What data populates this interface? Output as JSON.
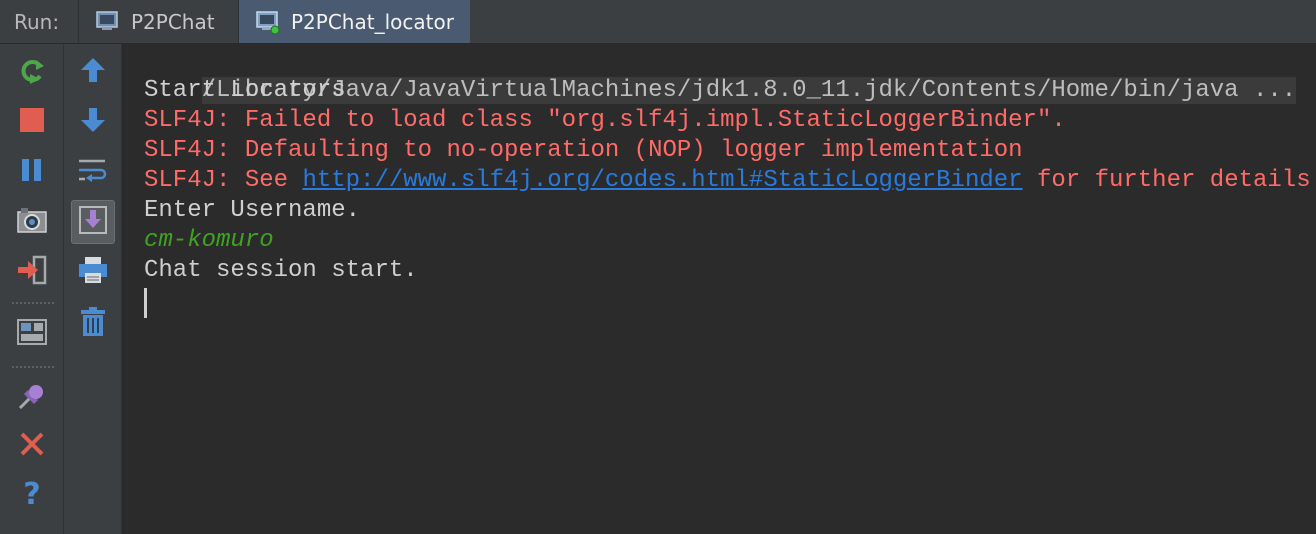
{
  "run_label": "Run:",
  "tabs": [
    {
      "label": "P2PChat",
      "active": false
    },
    {
      "label": "P2PChat_locator",
      "active": true
    }
  ],
  "left_toolbar": [
    {
      "icon": "rerun-icon"
    },
    {
      "icon": "stop-icon"
    },
    {
      "icon": "pause-icon"
    },
    {
      "icon": "camera-icon"
    },
    {
      "icon": "exit-icon"
    },
    {
      "icon": "layout-icon"
    },
    {
      "icon": "pin-icon"
    },
    {
      "icon": "close-icon"
    },
    {
      "icon": "help-icon"
    }
  ],
  "right_toolbar": [
    {
      "icon": "arrow-up-icon"
    },
    {
      "icon": "arrow-down-icon"
    },
    {
      "icon": "soft-wrap-icon"
    },
    {
      "icon": "scroll-to-end-icon",
      "pressed": true
    },
    {
      "icon": "print-icon"
    },
    {
      "icon": "trash-icon"
    }
  ],
  "colors": {
    "error": "#ff6b68",
    "link": "#287bde",
    "user_input": "#3fa31f",
    "normal": "#cfcfcf"
  },
  "console": {
    "command": "/Library/Java/JavaVirtualMachines/jdk1.8.0_11.jdk/Contents/Home/bin/java ...",
    "line1": "Start Locators",
    "line2": "SLF4J: Failed to load class \"org.slf4j.impl.StaticLoggerBinder\".",
    "line3": "SLF4J: Defaulting to no-operation (NOP) logger implementation",
    "line4_prefix": "SLF4J: See ",
    "line4_link": "http://www.slf4j.org/codes.html#StaticLoggerBinder",
    "line4_suffix": " for further details.",
    "line5": "Enter Username.",
    "line6": "cm-komuro",
    "line7": "Chat session start."
  }
}
